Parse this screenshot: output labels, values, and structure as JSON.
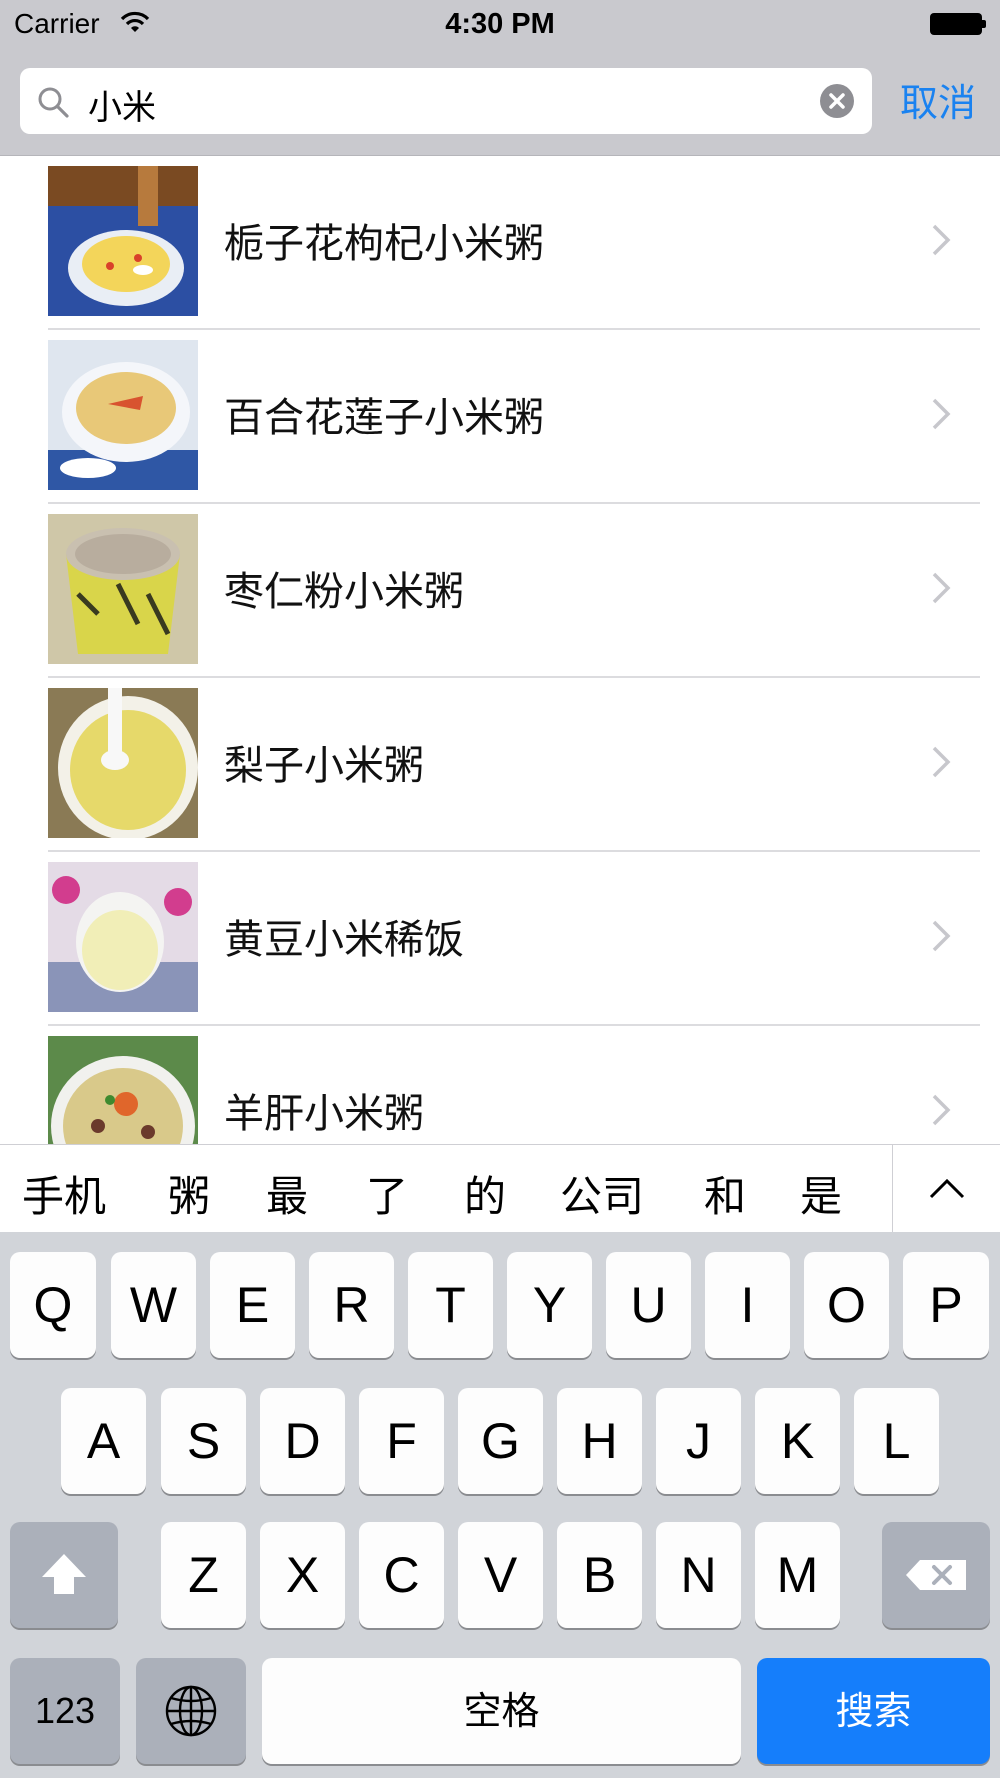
{
  "status_bar": {
    "carrier": "Carrier",
    "time": "4:30 PM"
  },
  "search": {
    "query": "小米",
    "cancel_label": "取消"
  },
  "results": [
    {
      "title": "栀子花枸杞小米粥"
    },
    {
      "title": "百合花莲子小米粥"
    },
    {
      "title": "枣仁粉小米粥"
    },
    {
      "title": "梨子小米粥"
    },
    {
      "title": "黄豆小米稀饭"
    },
    {
      "title": "羊肝小米粥"
    }
  ],
  "candidates": [
    "手机",
    "粥",
    "最",
    "了",
    "的",
    "公司",
    "和",
    "是"
  ],
  "keyboard": {
    "row1": [
      "Q",
      "W",
      "E",
      "R",
      "T",
      "Y",
      "U",
      "I",
      "O",
      "P"
    ],
    "row2": [
      "A",
      "S",
      "D",
      "F",
      "G",
      "H",
      "J",
      "K",
      "L"
    ],
    "row3": [
      "Z",
      "X",
      "C",
      "V",
      "B",
      "N",
      "M"
    ],
    "numbers_label": "123",
    "space_label": "空格",
    "search_label": "搜索"
  },
  "colors": {
    "accent": "#1a82f0",
    "search_key": "#157efb",
    "keyboard_bg": "#d1d4d9"
  }
}
